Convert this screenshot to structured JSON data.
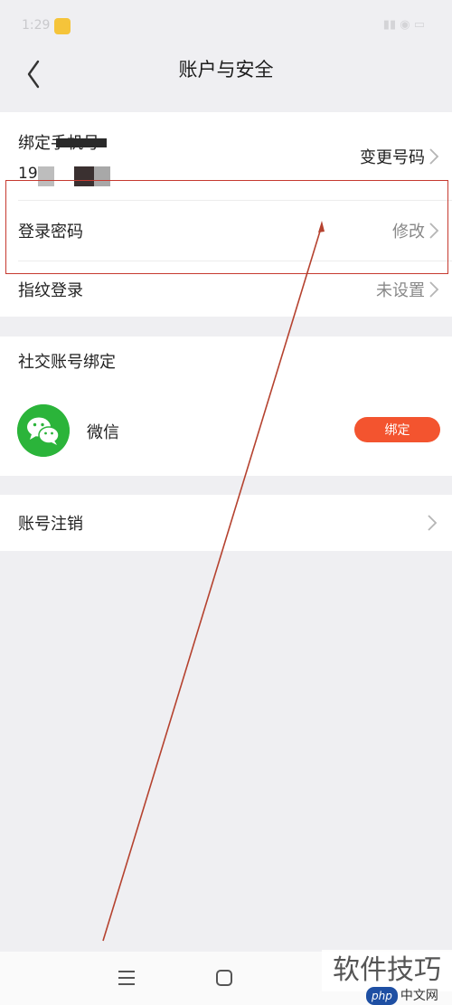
{
  "status_bar": {
    "time": "1:29"
  },
  "header": {
    "title": "账户与安全"
  },
  "account": {
    "phone_label": "绑定手机号",
    "phone_number": "19",
    "phone_action": "变更号码",
    "password_label": "登录密码",
    "password_action": "修改",
    "fingerprint_label": "指纹登录",
    "fingerprint_status": "未设置"
  },
  "social": {
    "title": "社交账号绑定",
    "items": [
      {
        "name": "微信",
        "icon": "wechat-icon",
        "action": "绑定",
        "accent": "#f3542f",
        "icon_color": "#2bb43a"
      }
    ]
  },
  "cancel": {
    "label": "账号注销"
  },
  "nav": {
    "menu_icon": "menu-icon",
    "home_icon": "home-icon"
  },
  "watermark": {
    "text": "软件技巧",
    "logo_php": "php",
    "logo_cn": "中文网"
  },
  "annotation": {
    "highlight_color": "#c63a30"
  }
}
